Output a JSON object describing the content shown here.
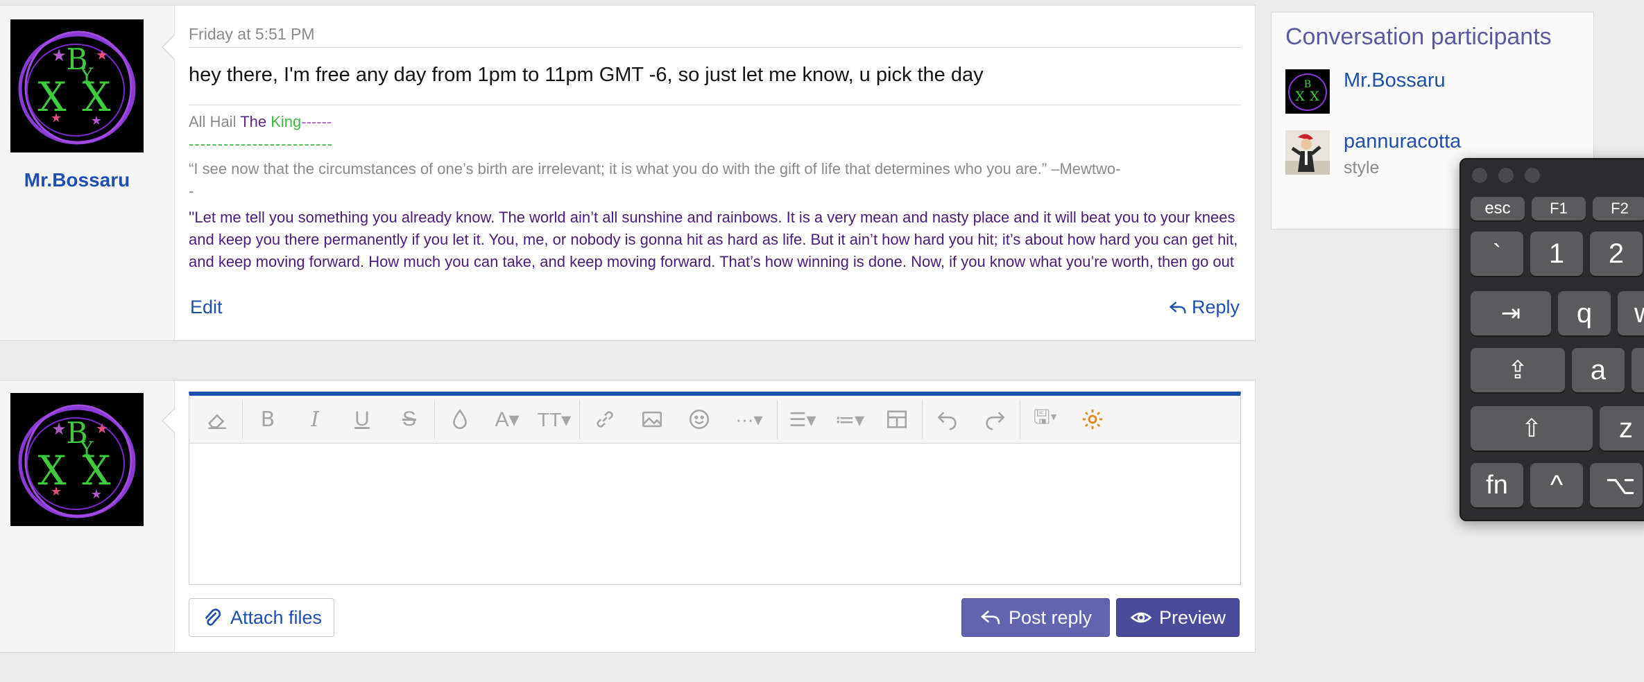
{
  "post": {
    "username": "Mr.Bossaru",
    "date": "Friday at 5:51 PM",
    "message": "hey there, I'm free any day from 1pm to 11pm GMT -6, so just let me know, u pick the day",
    "signature": {
      "hail_prefix": "All Hail ",
      "hail_the": "The",
      "hail_king": "King",
      "hail_suffix": "------",
      "green_dashes": "-------------------------",
      "quote1": "“I see now that the circumstances of one’s birth are irrelevant; it is what you do with the gift of life that determines who you are.” –Mewtwo-",
      "quote1_tail": "-",
      "quote2": "''Let me tell you something you already know. The world ain’t all sunshine and rainbows. It is a very mean and nasty place and it will beat you to your knees and keep you there permanently if you let it. You, me, or nobody is gonna hit as hard as life. But it ain’t how hard you hit; it’s about how hard you can get hit, and keep moving forward. How much you can take, and keep moving forward. That’s how winning is done. Now, if you know what you’re worth, then go out and get what you’re worth. But you gotta be willing to take the hit, and not pointing fingers"
    },
    "edit_label": "Edit",
    "reply_label": "Reply"
  },
  "editor": {
    "attach_label": "Attach files",
    "post_reply_label": "Post reply",
    "preview_label": "Preview",
    "toolbar_icons": [
      "eraser-icon",
      "bold-icon",
      "italic-icon",
      "underline-icon",
      "strikethrough-icon",
      "color-drop-icon",
      "font-family-icon",
      "font-size-icon",
      "link-icon",
      "image-icon",
      "emoji-icon",
      "more-icon",
      "align-icon",
      "list-icon",
      "table-icon",
      "undo-icon",
      "redo-icon",
      "drafts-icon",
      "gear-icon"
    ]
  },
  "sidebar": {
    "title": "Conversation participants",
    "participants": [
      {
        "name": "Mr.Bossaru",
        "sub": ""
      },
      {
        "name": "pannuracotta",
        "sub": "style"
      }
    ]
  },
  "keyboard": {
    "row1": [
      "esc",
      "F1",
      "F2"
    ],
    "row2": [
      "`",
      "1",
      "2"
    ],
    "row3": [
      "⇥",
      "q",
      "w"
    ],
    "row4": [
      "⇪",
      "a"
    ],
    "row5": [
      "⇧",
      "z"
    ],
    "row6": [
      "fn",
      "^",
      "⌥"
    ]
  },
  "colors": {
    "accent": "#1f4fae",
    "button_primary": "#6364b0",
    "button_secondary": "#4b4b9c",
    "gear": "#e08a1e"
  }
}
